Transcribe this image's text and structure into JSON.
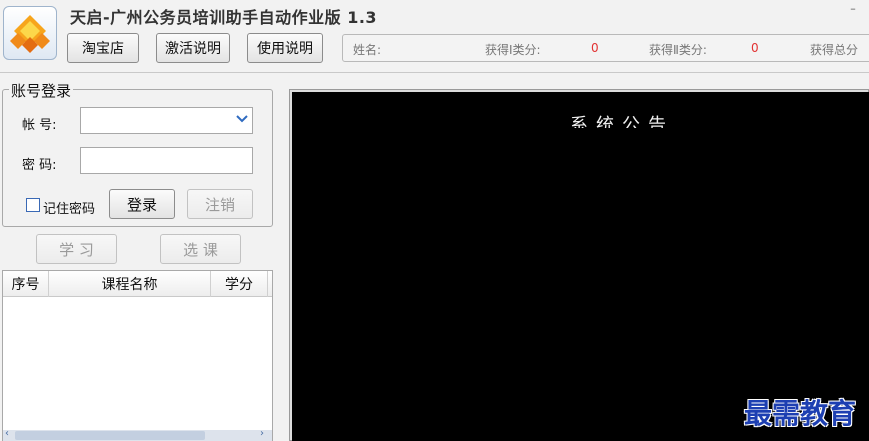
{
  "header": {
    "title": "天启-广州公务员培训助手自动作业版 1.3",
    "minimize_glyph": "–",
    "buttons": {
      "taobao": "淘宝店",
      "activation": "激活说明",
      "usage": "使用说明"
    },
    "info": {
      "name_label": "姓名:",
      "class1_label": "获得Ⅰ类分:",
      "class1_value": "0",
      "class2_label": "获得Ⅱ类分:",
      "class2_value": "0",
      "total_label": "获得总分"
    }
  },
  "login": {
    "group_title": "账号登录",
    "account_label": "帐  号:",
    "account_value": "",
    "password_label": "密  码:",
    "password_value": "",
    "remember_label": "记住密码",
    "login_button": "登录",
    "logout_button": "注销"
  },
  "actions": {
    "study": "学 习",
    "select_course": "选 课"
  },
  "course_list": {
    "columns": [
      "序号",
      "课程名称",
      "学分"
    ],
    "rows": []
  },
  "video": {
    "text": "系统公告"
  },
  "watermark": "最需教育",
  "colors": {
    "accent": "#2f6bc0",
    "value_red": "#e23131",
    "watermark_blue": "#1d3fb2"
  },
  "icons": {
    "logo": "diamond-logo-icon",
    "dropdown": "chevron-down-icon"
  }
}
